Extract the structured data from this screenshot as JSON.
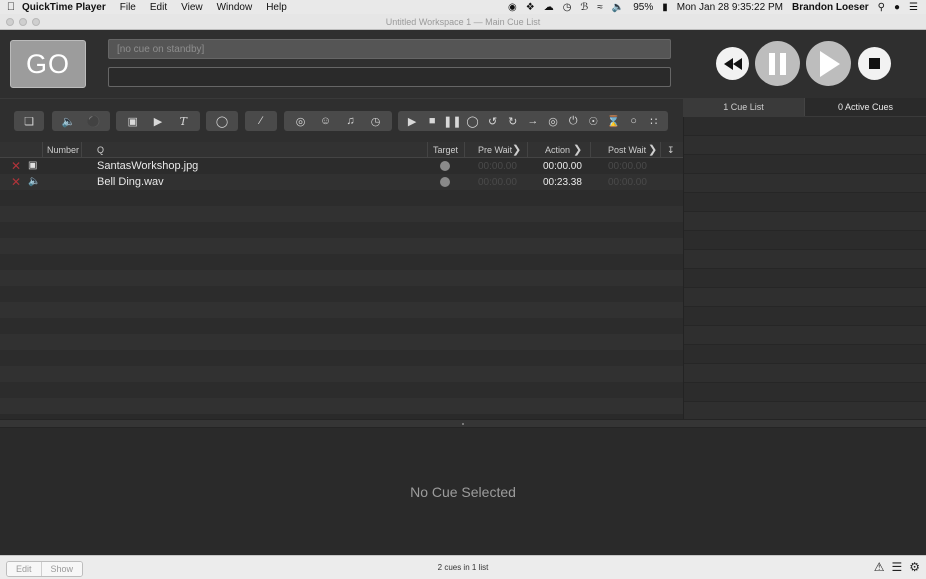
{
  "menubar": {
    "app_name": "QuickTime Player",
    "menus": [
      "File",
      "Edit",
      "View",
      "Window",
      "Help"
    ],
    "battery": "95%",
    "datetime": "Mon Jan 28  9:35:22 PM",
    "user": "Brandon Loeser"
  },
  "window": {
    "title": "Untitled Workspace 1 — Main Cue List"
  },
  "go_button": {
    "label": "GO"
  },
  "standby": {
    "placeholder": "[no cue on standby]",
    "notes_value": ""
  },
  "right_tabs": {
    "cue_lists": "1 Cue List",
    "active_cues": "0 Active Cues"
  },
  "cue_columns": {
    "number": "Number",
    "q": "Q",
    "target": "Target",
    "pre_wait": "Pre Wait",
    "action": "Action",
    "post_wait": "Post Wait"
  },
  "cues": [
    {
      "type_icon": "video-icon",
      "name": "SantasWorkshop.jpg",
      "pre_wait": "00:00.00",
      "action": "00:00.00",
      "post_wait": "00:00.00"
    },
    {
      "type_icon": "audio-icon",
      "name": "Bell Ding.wav",
      "pre_wait": "00:00.00",
      "action": "00:23.38",
      "post_wait": "00:00.00"
    }
  ],
  "inspector": {
    "empty_label": "No Cue Selected"
  },
  "statusbar": {
    "mode_edit": "Edit",
    "mode_show": "Show",
    "cue_count": "2 cues in 1 list"
  },
  "colors": {
    "go_button": "#9c9c9c",
    "broken_cue_x": "#b0343a",
    "background": "#2a2a2a"
  }
}
